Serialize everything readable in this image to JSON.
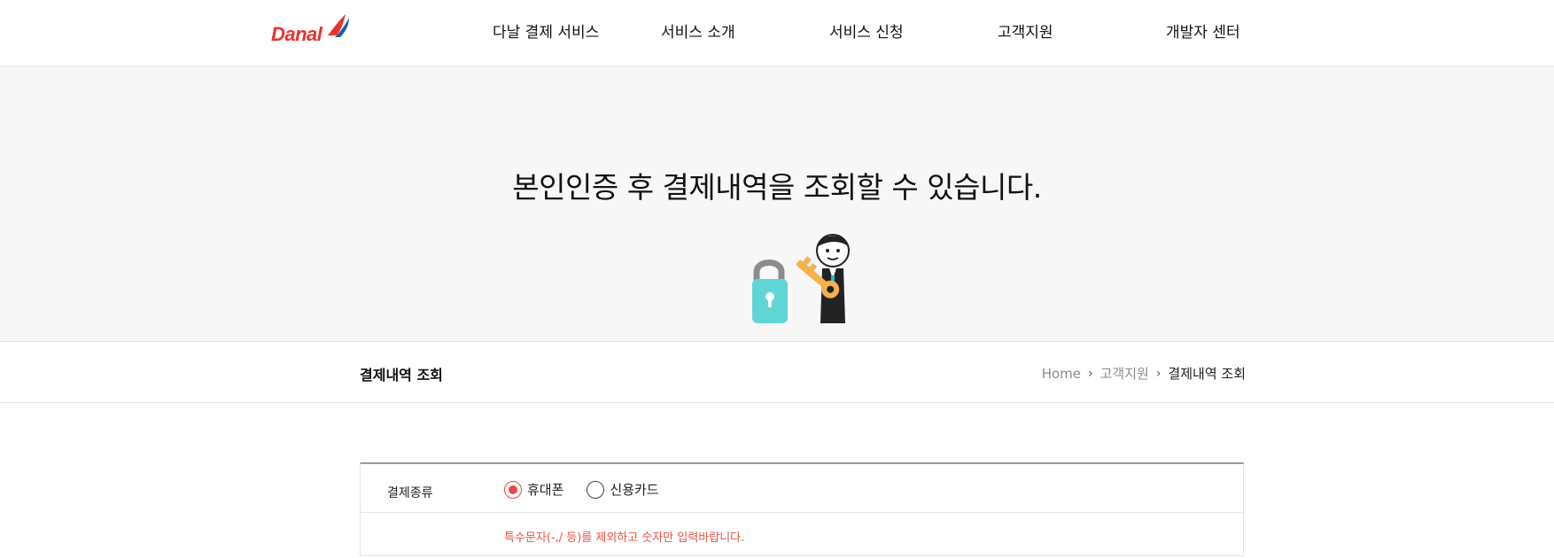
{
  "header": {
    "logo_text": "Danal",
    "nav": [
      "다날 결제 서비스",
      "서비스 소개",
      "서비스 신청",
      "고객지원",
      "개발자 센터"
    ]
  },
  "hero": {
    "title": "본인인증 후 결제내역을 조회할 수 있습니다."
  },
  "page": {
    "title": "결제내역 조회",
    "breadcrumb": [
      "Home",
      "고객지원",
      "결제내역 조회"
    ]
  },
  "form": {
    "payment_type_label": "결제종류",
    "options": [
      {
        "label": "휴대폰",
        "checked": true
      },
      {
        "label": "신용카드",
        "checked": false
      }
    ],
    "notice": "특수문자(-,/ 등)를 제외하고 숫자만 입력바랍니다."
  },
  "colors": {
    "brand": "#e8342e",
    "accent": "#e84848",
    "lock": "#5fd6d6",
    "key": "#f3b24a"
  }
}
